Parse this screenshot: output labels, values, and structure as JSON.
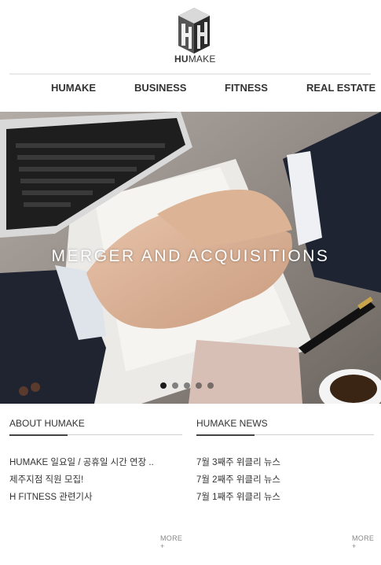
{
  "header": {
    "logo_letters": "HUMAKE",
    "logo_icon": "hh-cube-logo"
  },
  "nav": {
    "items": [
      {
        "label": "HUMAKE"
      },
      {
        "label": "BUSINESS"
      },
      {
        "label": "FITNESS"
      },
      {
        "label": "REAL ESTATE"
      }
    ]
  },
  "hero": {
    "title": "MERGER AND ACQUISITIONS",
    "slide_count": 5,
    "active_slide": 1
  },
  "about": {
    "title": "ABOUT HUMAKE",
    "items": [
      "HUMAKE 일요일 / 공휴일 시간 연장 ..",
      "제주지점 직원 모집!",
      "H FITNESS 관련기사"
    ],
    "more": "MORE +"
  },
  "news": {
    "title": "HUMAKE NEWS",
    "items": [
      "7월 3째주 위클리 뉴스",
      "7월 2째주 위클리 뉴스",
      "7월 1째주 위클리 뉴스"
    ],
    "more": "MORE +"
  }
}
